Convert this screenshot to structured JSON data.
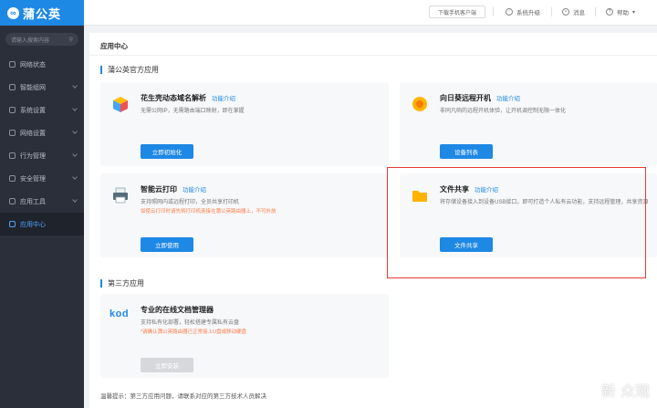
{
  "app": {
    "logo_text": "蒲公英",
    "logo_mark": "∞"
  },
  "sidebar": {
    "search_placeholder": "请输入搜索内容",
    "items": [
      {
        "label": "网络状态",
        "icon": "signal-icon",
        "chevron": false
      },
      {
        "label": "智能组网",
        "icon": "network-icon",
        "chevron": true
      },
      {
        "label": "系统设置",
        "icon": "settings-icon",
        "chevron": true
      },
      {
        "label": "网络设置",
        "icon": "globe-icon",
        "chevron": true
      },
      {
        "label": "行为管理",
        "icon": "behavior-icon",
        "chevron": true
      },
      {
        "label": "安全管理",
        "icon": "shield-icon",
        "chevron": true
      },
      {
        "label": "应用工具",
        "icon": "tools-icon",
        "chevron": true
      },
      {
        "label": "应用中心",
        "icon": "apps-icon",
        "chevron": false,
        "active": true
      }
    ]
  },
  "topbar": {
    "download_label": "下载手机客户端",
    "upgrade_label": "系统升级",
    "messages_label": "消息",
    "help_label": "帮助"
  },
  "main": {
    "page_title": "应用中心",
    "official_section": "蒲公英官方应用",
    "third_party_section": "第三方应用",
    "footer_note": "温馨提示：第三方应用问题，请联系对应的第三方技术人员解决",
    "feature_link": "功能介绍",
    "cards": [
      {
        "name": "花生壳动态域名解析",
        "desc": "无需公网IP，无需路由端口映射，即在掌握",
        "button": "立即初始化"
      },
      {
        "name": "向日葵远程开机",
        "desc": "非同凡响的远程开机体验，让开机调控制无限一体化",
        "button": "设备列表"
      },
      {
        "name": "智能云打印",
        "desc": "支持照网内或远程打印，全员共享打印机",
        "warn": "如使云打印时请先将打印机连接在蒲公英路由器上，不可外放",
        "button": "立即使用"
      },
      {
        "name": "文件共享",
        "desc": "将存储设备接入到设备USB接口，即可打造个人私有云功能，支持远程管理，共享资源",
        "button": "文件共享"
      }
    ],
    "third_party_card": {
      "logo": "kod",
      "name": "专业的在线文档管理器",
      "desc": "支持私有化部署，轻松搭建专属私有云盘",
      "warn": "*请确认蒲公英路由器已正常接上U盘或移动硬盘",
      "button": "立即安装"
    }
  },
  "watermark": "新 众观",
  "colors": {
    "accent": "#1e88e5",
    "sidebar_bg": "#2b2f3a",
    "highlight": "#e53935"
  }
}
